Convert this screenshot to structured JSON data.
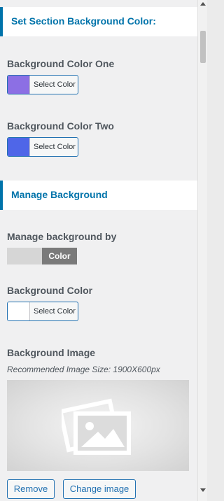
{
  "section1": {
    "title": "Set Section Background Color:"
  },
  "color_one": {
    "label": "Background Color One",
    "button_text": "Select Color",
    "swatch": "#8c6fe4"
  },
  "color_two": {
    "label": "Background Color Two",
    "button_text": "Select Color",
    "swatch": "#4f66e8"
  },
  "section2": {
    "title": "Manage Background"
  },
  "manage_by": {
    "label": "Manage background by",
    "active_option": "Color"
  },
  "bg_color": {
    "label": "Background Color",
    "button_text": "Select Color",
    "swatch": "#ffffff"
  },
  "bg_image": {
    "label": "Background Image",
    "note": "Recommended Image Size: 1900X600px",
    "placeholder_icon": "image-placeholder-icon",
    "remove_label": "Remove",
    "change_label": "Change image"
  },
  "colors": {
    "accent": "#0073aa",
    "button_border": "#2271b1"
  }
}
